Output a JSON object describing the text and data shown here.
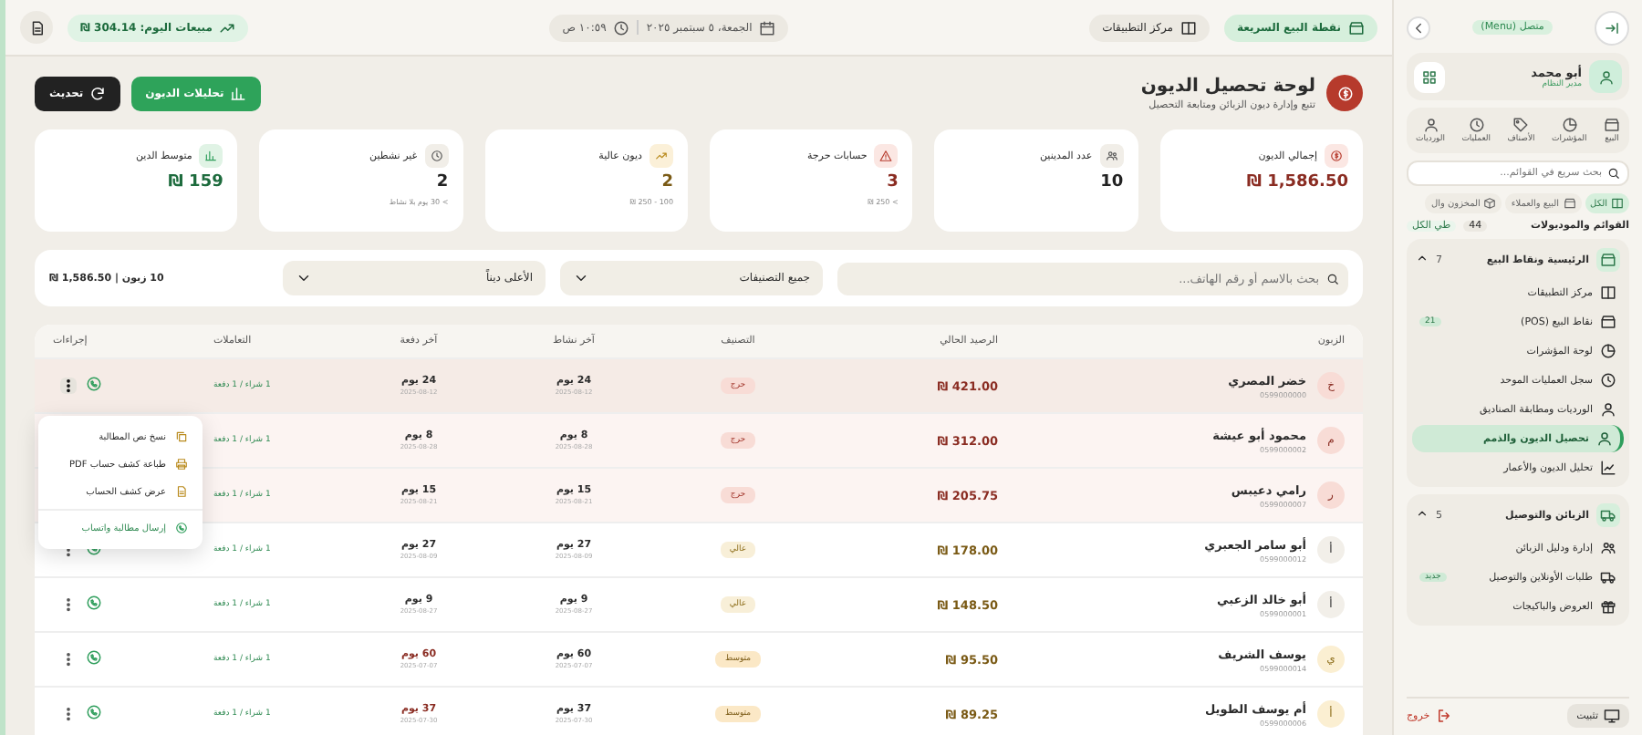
{
  "topbar": {
    "quick_pos": "نقطة البيع السريعة",
    "app_center": "مركز التطبيقات",
    "date": "الجمعة، ٥ سبتمبر ٢٠٢٥",
    "time": "١٠:٥٩ ص",
    "sales_today": "مبيعات اليوم: 304.14 ₪"
  },
  "header": {
    "title": "لوحة تحصيل الديون",
    "subtitle": "تتبع وإدارة ديون الزبائن ومتابعة التحصيل",
    "buttons": [
      {
        "label": "تحليلات الديون",
        "kind": "primary"
      },
      {
        "label": "تحديث",
        "kind": "dark"
      }
    ]
  },
  "stats": [
    {
      "label": "إجمالي الديون",
      "value": "₪ 1,586.50",
      "kind": "danger"
    },
    {
      "label": "عدد المدينين",
      "value": "10",
      "kind": "neutral"
    },
    {
      "label": "حسابات حرجة",
      "value": "3",
      "note": "> 250 ₪",
      "kind": "danger"
    },
    {
      "label": "ديون عالية",
      "value": "2",
      "note": "100 - 250 ₪",
      "kind": "warning"
    },
    {
      "label": "غير نشطين",
      "value": "2",
      "note": "> 30 يوم بلا نشاط",
      "kind": "neutral"
    },
    {
      "label": "متوسط الدين",
      "value": "₪ 159",
      "kind": "success"
    }
  ],
  "filters": {
    "search_placeholder": "بحث بالاسم أو رقم الهاتف...",
    "category": "جميع التصنيفات",
    "sort": "الأعلى ديناً",
    "summary": "10 زبون | 1,586.50 ₪"
  },
  "table": {
    "columns": [
      "الزبون",
      "الرصيد الحالي",
      "التصنيف",
      "آخر نشاط",
      "آخر دفعة",
      "التعاملات",
      "إجراءات"
    ],
    "rows": [
      {
        "initial": "خ",
        "name": "خضر المصري",
        "phone": "0599000000",
        "balance": "₪ 421.00",
        "category": "حرج",
        "kind": "critical",
        "activity": "24 يوم",
        "activity_date": "2025-08-12",
        "payment": "24 يوم",
        "payment_date": "2025-08-12",
        "payment_overdue": false,
        "transactions": "1 شراء / 1 دفعة",
        "menu_open": true
      },
      {
        "initial": "م",
        "name": "محمود أبو عيشة",
        "phone": "0599000002",
        "balance": "₪ 312.00",
        "category": "حرج",
        "kind": "critical",
        "activity": "8 يوم",
        "activity_date": "2025-08-28",
        "payment": "8 يوم",
        "payment_date": "2025-08-28",
        "payment_overdue": false,
        "transactions": "1 شراء / 1 دفعة",
        "menu_open": false
      },
      {
        "initial": "ر",
        "name": "رامي دعيبس",
        "phone": "0599000007",
        "balance": "₪ 205.75",
        "category": "حرج",
        "kind": "critical",
        "activity": "15 يوم",
        "activity_date": "2025-08-21",
        "payment": "15 يوم",
        "payment_date": "2025-08-21",
        "payment_overdue": false,
        "transactions": "1 شراء / 1 دفعة",
        "menu_open": false
      },
      {
        "initial": "أ",
        "name": "أبو سامر الجعبري",
        "phone": "0599000012",
        "balance": "₪ 178.00",
        "category": "عالي",
        "kind": "high",
        "activity": "27 يوم",
        "activity_date": "2025-08-09",
        "payment": "27 يوم",
        "payment_date": "2025-08-09",
        "payment_overdue": false,
        "transactions": "1 شراء / 1 دفعة",
        "menu_open": false
      },
      {
        "initial": "أ",
        "name": "أبو خالد الزعبي",
        "phone": "0599000001",
        "balance": "₪ 148.50",
        "category": "عالي",
        "kind": "high",
        "activity": "9 يوم",
        "activity_date": "2025-08-27",
        "payment": "9 يوم",
        "payment_date": "2025-08-27",
        "payment_overdue": false,
        "transactions": "1 شراء / 1 دفعة",
        "menu_open": false
      },
      {
        "initial": "ي",
        "name": "يوسف الشريف",
        "phone": "0599000014",
        "balance": "₪ 95.50",
        "category": "متوسط",
        "kind": "medium",
        "activity": "60 يوم",
        "activity_date": "2025-07-07",
        "payment": "60 يوم",
        "payment_date": "2025-07-07",
        "payment_overdue": true,
        "transactions": "1 شراء / 1 دفعة",
        "menu_open": false
      },
      {
        "initial": "أ",
        "name": "أم يوسف الطويل",
        "phone": "0599000006",
        "balance": "₪ 89.25",
        "category": "متوسط",
        "kind": "medium",
        "activity": "37 يوم",
        "activity_date": "2025-07-30",
        "payment": "37 يوم",
        "payment_date": "2025-07-30",
        "payment_overdue": true,
        "transactions": "1 شراء / 1 دفعة",
        "menu_open": false
      }
    ],
    "action_menu": [
      {
        "label": "نسخ نص المطالبة",
        "kind": "copy"
      },
      {
        "label": "طباعة كشف حساب PDF",
        "kind": "print"
      },
      {
        "label": "عرض كشف الحساب",
        "kind": "statement"
      },
      {
        "label": "إرسال مطالبة واتساب",
        "kind": "whatsapp"
      }
    ]
  },
  "sidebar": {
    "status": "متصل (Menu)",
    "user": {
      "name": "أبو محمد",
      "role": "مدير النظام"
    },
    "tabs": [
      {
        "label": "البيع",
        "selected": false
      },
      {
        "label": "المؤشرات",
        "selected": false
      },
      {
        "label": "الأصناف",
        "selected": false
      },
      {
        "label": "العمليات",
        "selected": false
      },
      {
        "label": "الورديات",
        "selected": false
      }
    ],
    "search_placeholder": "بحث سريع في القوائم...",
    "chips": [
      {
        "label": "الكل",
        "selected": true
      },
      {
        "label": "البيع والعملاء",
        "selected": false
      },
      {
        "label": "المخزون وال",
        "selected": false
      }
    ],
    "modules_label": "القوائم والموديولات",
    "modules_count": "44",
    "collapse_all": "طي الكل",
    "sections": [
      {
        "title": "الرئيسية ونقاط البيع",
        "count": "7",
        "expanded": true,
        "items": [
          {
            "label": "مركز التطبيقات",
            "selected": false
          },
          {
            "label": "نقاط البيع (POS)",
            "badge": "21",
            "selected": false
          },
          {
            "label": "لوحة المؤشرات",
            "selected": false
          },
          {
            "label": "سجل العمليات الموحد",
            "selected": false
          },
          {
            "label": "الورديات ومطابقة الصناديق",
            "selected": false
          },
          {
            "label": "تحصيل الديون والذمم",
            "selected": true
          },
          {
            "label": "تحليل الديون والأعمار",
            "selected": false
          }
        ]
      },
      {
        "title": "الزبائن والتوصيل",
        "count": "5",
        "expanded": true,
        "items": [
          {
            "label": "إدارة ودليل الزبائن",
            "selected": false
          },
          {
            "label": "طلبات الأونلاين والتوصيل",
            "badge": "جديد",
            "selected": false
          },
          {
            "label": "العروض والباكيجات",
            "selected": false
          }
        ]
      }
    ],
    "install": "تثبيت",
    "logout": "خروج"
  }
}
